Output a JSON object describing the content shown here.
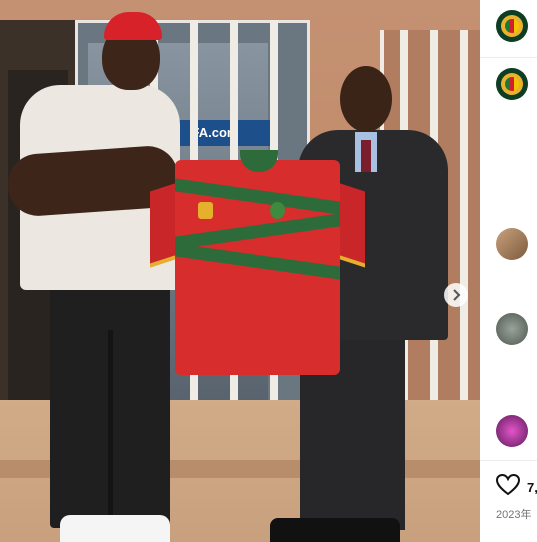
{
  "post": {
    "likes_text": "7,",
    "date_text": "2023年",
    "sign_text": "FA.com"
  },
  "icons": {
    "next": "chevron-right-icon",
    "like": "heart-icon"
  },
  "colors": {
    "jersey_red": "#d72d2c",
    "jersey_green": "#2e6b3a",
    "jersey_gold": "#e5b12d",
    "federation_avatar_bg": "#0d3d22"
  }
}
